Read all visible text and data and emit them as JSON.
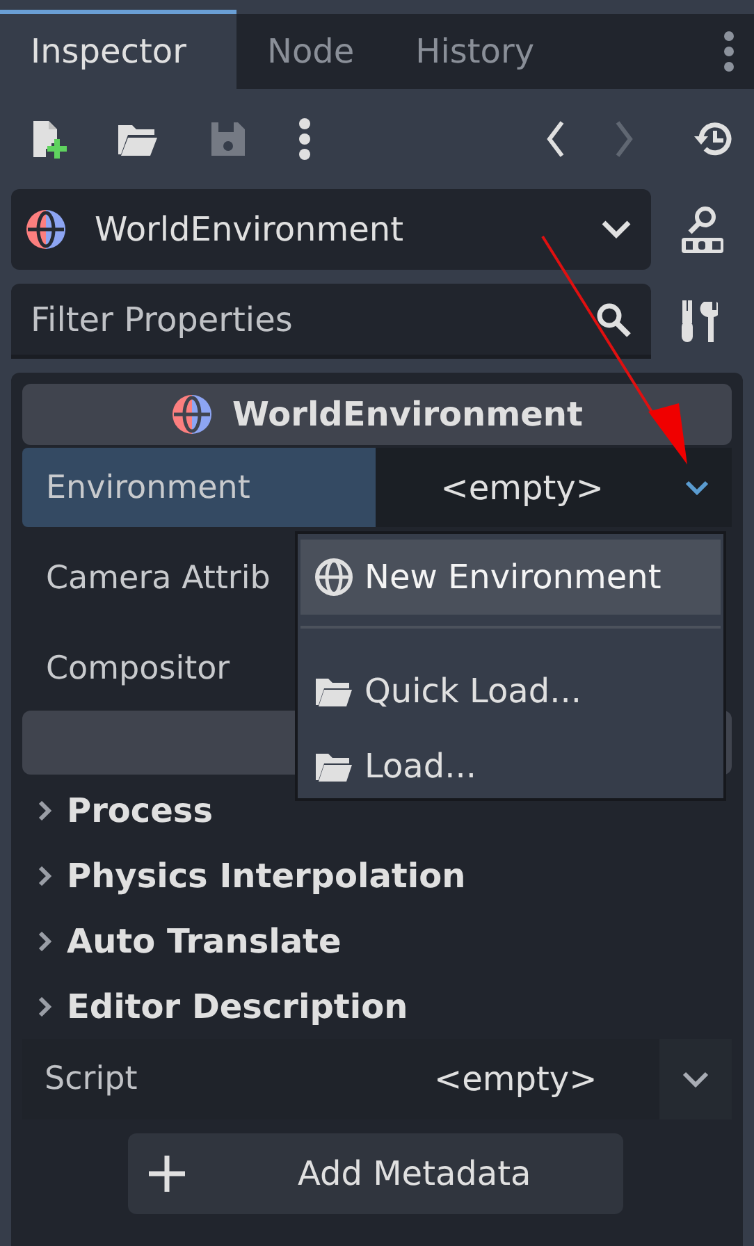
{
  "tabs": [
    {
      "label": "Inspector",
      "selected": true
    },
    {
      "label": "Node",
      "selected": false
    },
    {
      "label": "History",
      "selected": false
    }
  ],
  "toolbar": [
    {
      "kind": "new",
      "disabled": false
    },
    {
      "kind": "open",
      "disabled": false
    },
    {
      "kind": "save",
      "disabled": true
    },
    {
      "kind": "more",
      "disabled": false
    },
    {
      "kind": "back",
      "disabled": false
    },
    {
      "kind": "forward",
      "disabled": true
    },
    {
      "kind": "history",
      "disabled": false
    }
  ],
  "object_selector": {
    "value": "WorldEnvironment"
  },
  "filter": {
    "placeholder": "Filter Properties"
  },
  "inspector": {
    "header": "WorldEnvironment",
    "properties": [
      {
        "label": "Environment",
        "value": "<empty>",
        "selected": true
      },
      {
        "label": "Camera Attrib",
        "selected": false
      },
      {
        "label": "Compositor",
        "selected": false
      }
    ],
    "sections": [
      {
        "label": "Process",
        "expanded": false
      },
      {
        "label": "Physics Interpolation",
        "expanded": false
      },
      {
        "label": "Auto Translate",
        "expanded": false
      },
      {
        "label": "Editor Description",
        "expanded": false
      }
    ],
    "script": {
      "label": "Script",
      "value": "<empty>"
    },
    "add_button": "Add Metadata"
  },
  "popup_menu": {
    "items": [
      {
        "kind": "globe",
        "label": "New Environment",
        "selected": true
      },
      {
        "kind": "separator"
      },
      {
        "kind": "folder",
        "label": "Quick Load...",
        "selected": false
      },
      {
        "kind": "folder",
        "label": "Load...",
        "selected": false
      }
    ]
  }
}
